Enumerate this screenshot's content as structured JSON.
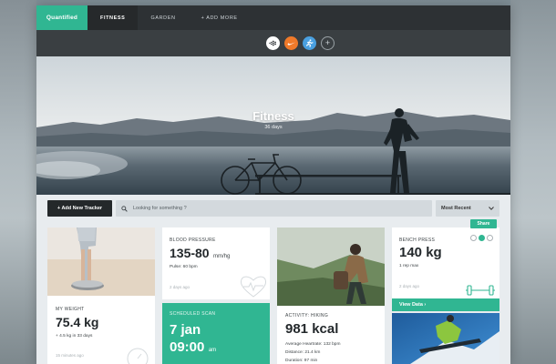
{
  "nav": {
    "brand": "Quantified",
    "tabs": [
      "FITNESS",
      "GARDEN",
      "+ ADD MORE"
    ]
  },
  "services": [
    "fitbit-icon",
    "nike-icon",
    "runkeeper-icon",
    "add-icon"
  ],
  "hero": {
    "title": "Fitness",
    "subtitle": "36 days"
  },
  "toolbar": {
    "add_label": "+ Add New Tracker",
    "search_placeholder": "Looking for something ?",
    "sort_value": "Most Recent"
  },
  "weight": {
    "label": "MY WEIGHT",
    "value": "75.4 kg",
    "change": "+ 4.5 kg in 33 days",
    "time": "15 minutes ago"
  },
  "bp": {
    "label": "BLOOD PRESSURE",
    "value": "135-80",
    "unit": "mm/hg",
    "pulse": "Pulse: 60 bpm",
    "time": "2 days ago"
  },
  "scan": {
    "label": "SCHEDULED SCAN",
    "date": "7 jan",
    "time": "09:00",
    "ampm": "am"
  },
  "activity": {
    "label": "ACTIVITY: HIKING",
    "value": "981 kcal",
    "heartrate": "Average Heartrate: 132 bpm",
    "distance": "Distance: 21.4 km",
    "duration": "Duration: 97 min"
  },
  "bench": {
    "label": "BENCH PRESS",
    "value": "140 kg",
    "sub": "1 rep max",
    "time": "2 days ago",
    "share": "Share",
    "view": "View Data ›"
  },
  "colors": {
    "accent": "#30b692",
    "dark": "#2d3134"
  }
}
